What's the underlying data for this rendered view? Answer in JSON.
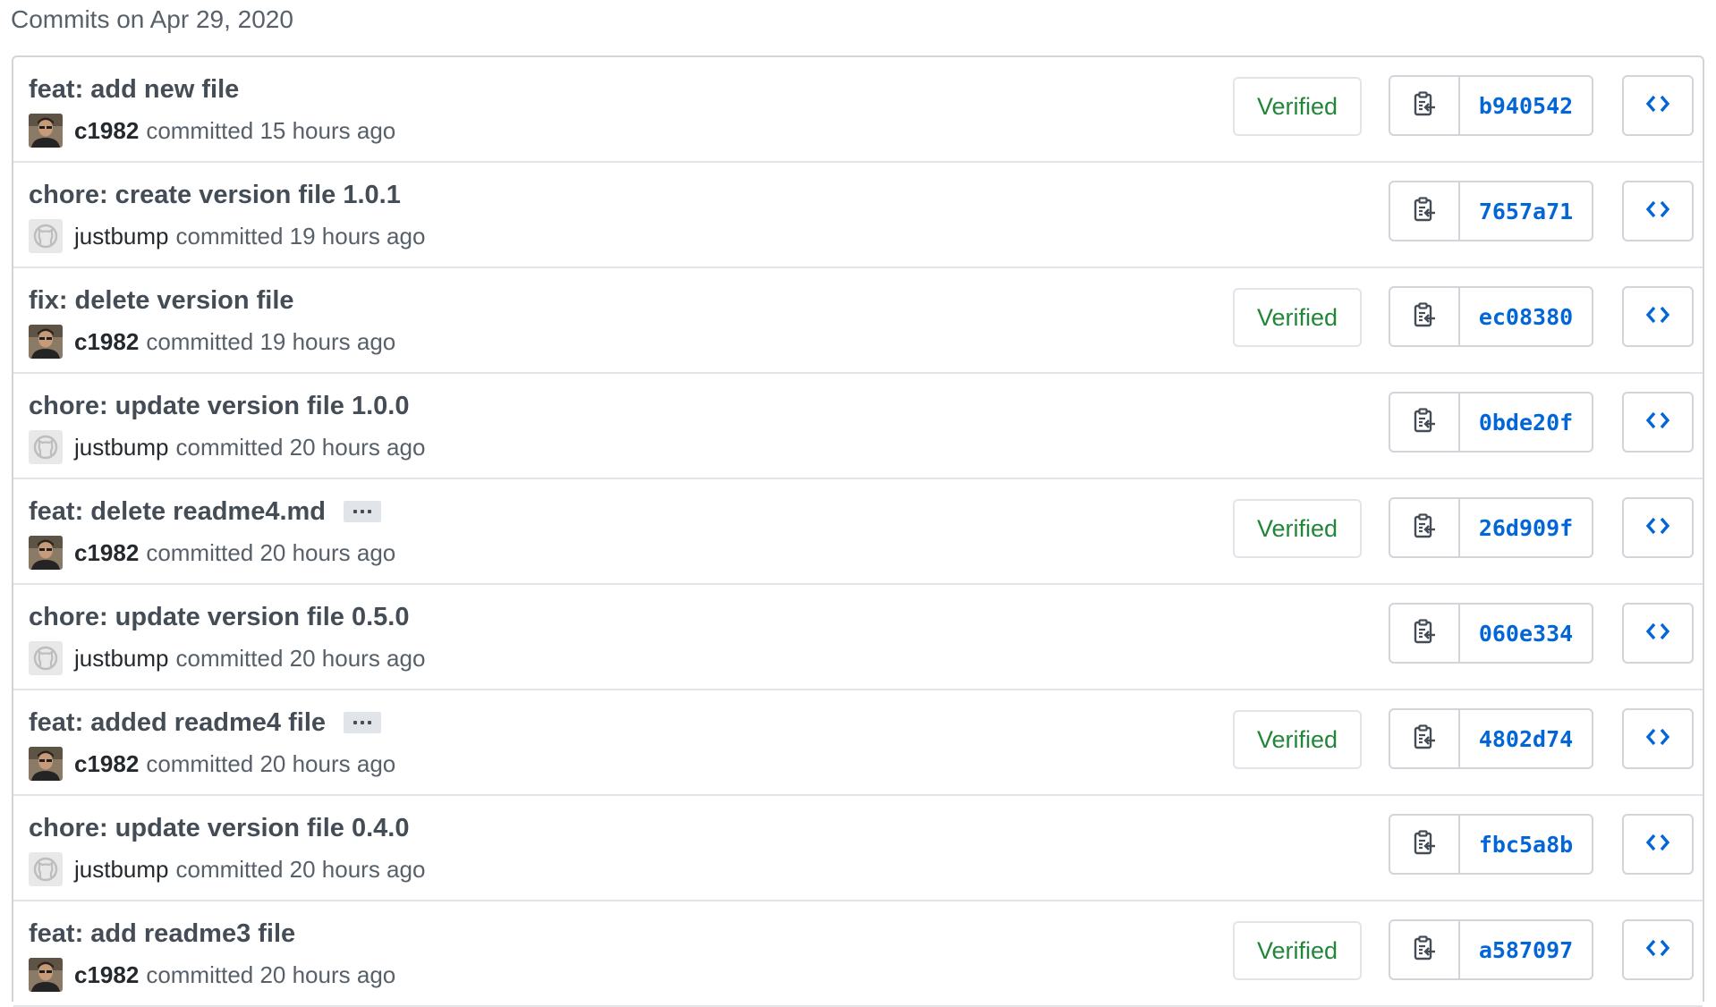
{
  "date_heading": "Commits on Apr 29, 2020",
  "colors": {
    "verified_green": "#22863a",
    "sha_blue": "#0366d6",
    "title_gray": "#444d56",
    "meta_gray": "#586069",
    "border_gray": "#d1d5da"
  },
  "commits": [
    {
      "title": "feat: add new file",
      "has_more": false,
      "author": "c1982",
      "avatar": "c1982-photo-avatar",
      "time": "committed 15 hours ago",
      "verified": "Verified",
      "sha": "b940542"
    },
    {
      "title": "chore: create version file 1.0.1",
      "has_more": false,
      "author": "justbump",
      "avatar": "github-default-avatar",
      "time": "committed 19 hours ago",
      "verified": null,
      "sha": "7657a71"
    },
    {
      "title": "fix: delete version file",
      "has_more": false,
      "author": "c1982",
      "avatar": "c1982-photo-avatar",
      "time": "committed 19 hours ago",
      "verified": "Verified",
      "sha": "ec08380"
    },
    {
      "title": "chore: update version file 1.0.0",
      "has_more": false,
      "author": "justbump",
      "avatar": "github-default-avatar",
      "time": "committed 20 hours ago",
      "verified": null,
      "sha": "0bde20f"
    },
    {
      "title": "feat: delete readme4.md",
      "has_more": true,
      "author": "c1982",
      "avatar": "c1982-photo-avatar",
      "time": "committed 20 hours ago",
      "verified": "Verified",
      "sha": "26d909f"
    },
    {
      "title": "chore: update version file 0.5.0",
      "has_more": false,
      "author": "justbump",
      "avatar": "github-default-avatar",
      "time": "committed 20 hours ago",
      "verified": null,
      "sha": "060e334"
    },
    {
      "title": "feat: added readme4 file",
      "has_more": true,
      "author": "c1982",
      "avatar": "c1982-photo-avatar",
      "time": "committed 20 hours ago",
      "verified": "Verified",
      "sha": "4802d74"
    },
    {
      "title": "chore: update version file 0.4.0",
      "has_more": false,
      "author": "justbump",
      "avatar": "github-default-avatar",
      "time": "committed 20 hours ago",
      "verified": null,
      "sha": "fbc5a8b"
    },
    {
      "title": "feat: add readme3 file",
      "has_more": false,
      "author": "c1982",
      "avatar": "c1982-photo-avatar",
      "time": "committed 20 hours ago",
      "verified": "Verified",
      "sha": "a587097"
    }
  ],
  "icons": {
    "copy": "clipboard-copy-icon",
    "browse": "code-brackets-icon",
    "more": "ellipsis-icon"
  }
}
